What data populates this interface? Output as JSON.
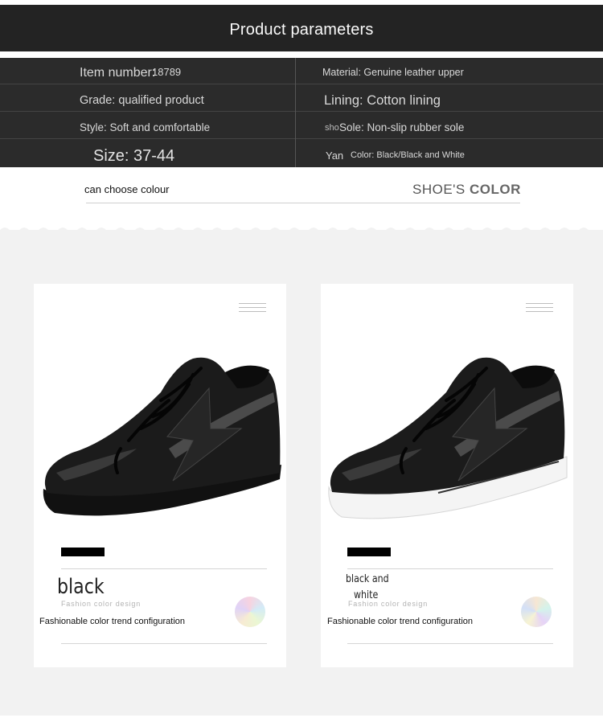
{
  "header": {
    "title": "Product parameters"
  },
  "params": {
    "item_number_label": "Item number:",
    "item_number_value": "18789",
    "material": "Material: Genuine leather upper",
    "grade": "Grade: qualified product",
    "lining": "Lining: Cotton lining",
    "style": "Style: Soft and comfortable",
    "sole_prefix": "sho",
    "sole": "Sole: Non-slip rubber sole",
    "size": "Size: 37-44",
    "color_prefix": "Yan",
    "color": "Color: Black/Black and White"
  },
  "color_section": {
    "choose_label": "can choose colour",
    "heading_light": "SHOE'S",
    "heading_bold": "COLOR"
  },
  "cards": [
    {
      "name": "black",
      "subtitle": "Fashion color design",
      "trend": "Fashionable color trend configuration",
      "sole_color": "#111111"
    },
    {
      "name_line1": "black and",
      "name_line2": "white",
      "subtitle": "Fashion color design",
      "trend": "Fashionable color trend configuration",
      "sole_color": "#f4f4f4"
    }
  ],
  "colors": {
    "header_bg": "#232323",
    "table_bg": "#2b2b2b",
    "panel_bg": "#f2f2f2"
  }
}
